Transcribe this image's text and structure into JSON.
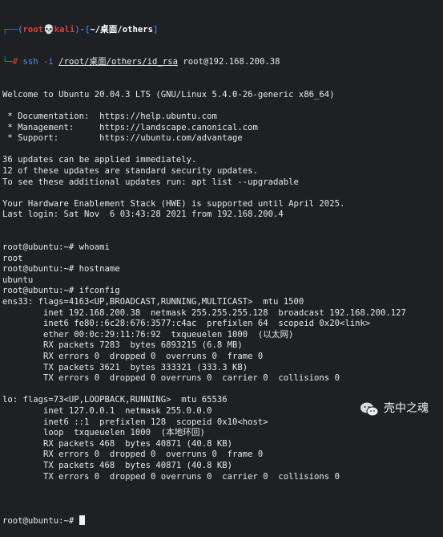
{
  "prompt": {
    "user": "root",
    "skull": "💀",
    "host": "kali",
    "path": "~/桌面/others"
  },
  "ssh": {
    "cmd": "ssh -i ",
    "keypath": "/root/桌面/others/id_rsa",
    "target": " root@192.168.200.38"
  },
  "motd": [
    "Welcome to Ubuntu 20.04.3 LTS (GNU/Linux 5.4.0-26-generic x86_64)",
    "",
    " * Documentation:  https://help.ubuntu.com",
    " * Management:     https://landscape.canonical.com",
    " * Support:        https://ubuntu.com/advantage",
    "",
    "36 updates can be applied immediately.",
    "12 of these updates are standard security updates.",
    "To see these additional updates run: apt list --upgradable",
    "",
    "Your Hardware Enablement Stack (HWE) is supported until April 2025.",
    "Last login: Sat Nov  6 03:43:28 2021 from 192.168.200.4"
  ],
  "session": [
    "root@ubuntu:~# whoami",
    "root",
    "root@ubuntu:~# hostname",
    "ubuntu",
    "root@ubuntu:~# ifconfig",
    "ens33: flags=4163<UP,BROADCAST,RUNNING,MULTICAST>  mtu 1500",
    "        inet 192.168.200.38  netmask 255.255.255.128  broadcast 192.168.200.127",
    "        inet6 fe80::6c28:676:3577:c4ac  prefixlen 64  scopeid 0x20<link>",
    "        ether 00:0c:29:11:76:92  txqueuelen 1000  (以太网)",
    "        RX packets 7283  bytes 6893215 (6.8 MB)",
    "        RX errors 0  dropped 0  overruns 0  frame 0",
    "        TX packets 3621  bytes 333321 (333.3 KB)",
    "        TX errors 0  dropped 0 overruns 0  carrier 0  collisions 0",
    "",
    "lo: flags=73<UP,LOOPBACK,RUNNING>  mtu 65536",
    "        inet 127.0.0.1  netmask 255.0.0.0",
    "        inet6 ::1  prefixlen 128  scopeid 0x10<host>",
    "        loop  txqueuelen 1000  (本地环回)",
    "        RX packets 468  bytes 40871 (40.8 KB)",
    "        RX errors 0  dropped 0  overruns 0  frame 0",
    "        TX packets 468  bytes 40871 (40.8 KB)",
    "        TX errors 0  dropped 0 overruns 0  carrier 0  collisions 0",
    ""
  ],
  "final_prompt": "root@ubuntu:~# ",
  "watermark": {
    "text": "壳中之魂"
  }
}
